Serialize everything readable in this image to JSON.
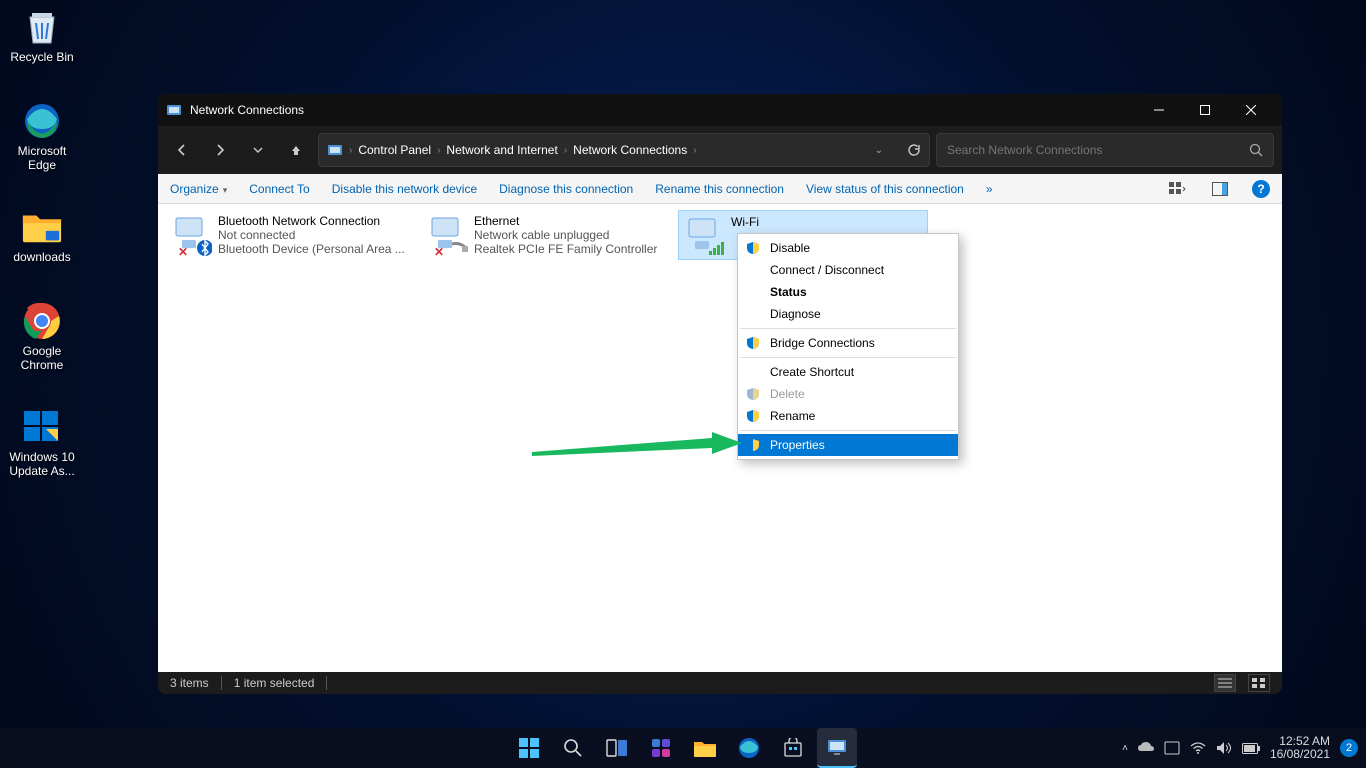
{
  "desktop": {
    "icons": [
      {
        "label": "Recycle Bin"
      },
      {
        "label": "Microsoft Edge"
      },
      {
        "label": "downloads"
      },
      {
        "label": "Google Chrome"
      },
      {
        "label": "Windows 10 Update As..."
      }
    ]
  },
  "window": {
    "title": "Network Connections",
    "breadcrumb": [
      "Control Panel",
      "Network and Internet",
      "Network Connections"
    ],
    "search_placeholder": "Search Network Connections",
    "commands": {
      "organize": "Organize",
      "connect_to": "Connect To",
      "disable": "Disable this network device",
      "diagnose": "Diagnose this connection",
      "rename": "Rename this connection",
      "view_status": "View status of this connection",
      "more": "»"
    },
    "connections": [
      {
        "name": "Bluetooth Network Connection",
        "status": "Not connected",
        "detail": "Bluetooth Device (Personal Area ..."
      },
      {
        "name": "Ethernet",
        "status": "Network cable unplugged",
        "detail": "Realtek PCIe FE Family Controller"
      },
      {
        "name": "Wi-Fi",
        "status": "",
        "detail": ""
      }
    ],
    "context_menu": {
      "disable": "Disable",
      "connect": "Connect / Disconnect",
      "status": "Status",
      "diagnose": "Diagnose",
      "bridge": "Bridge Connections",
      "shortcut": "Create Shortcut",
      "delete": "Delete",
      "rename": "Rename",
      "properties": "Properties"
    },
    "status": {
      "items": "3 items",
      "selected": "1 item selected"
    }
  },
  "taskbar": {
    "time": "12:52 AM",
    "date": "16/08/2021",
    "notif": "2"
  }
}
